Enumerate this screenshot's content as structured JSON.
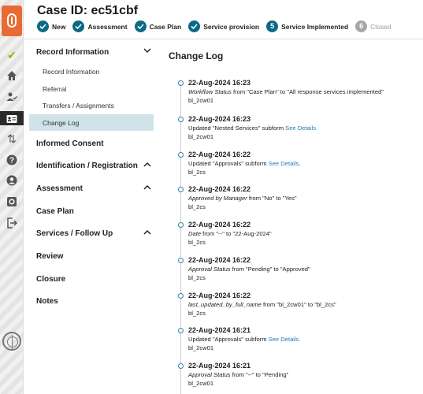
{
  "header": {
    "title": "Case ID: ec51cbf",
    "steps": [
      {
        "label": "New",
        "state": "done"
      },
      {
        "label": "Assessment",
        "state": "done"
      },
      {
        "label": "Case Plan",
        "state": "done"
      },
      {
        "label": "Service provision",
        "state": "done"
      },
      {
        "label": "Service Implemented",
        "state": "current",
        "number": "5"
      },
      {
        "label": "Closed",
        "state": "pending",
        "number": "6"
      }
    ]
  },
  "rail": {
    "icons": [
      "check-icon",
      "home-icon",
      "user-check-icon",
      "id-card-icon",
      "swap-icon",
      "help-icon",
      "user-circle-icon",
      "settings-icon",
      "logout-icon"
    ]
  },
  "nav": {
    "record_info": {
      "label": "Record Information",
      "items": [
        "Record Information",
        "Referral",
        "Transfers / Assignments",
        "Change Log"
      ]
    },
    "informed_consent": "Informed Consent",
    "identification": "Identification / Registration",
    "assessment": "Assessment",
    "case_plan": "Case Plan",
    "services": "Services / Follow Up",
    "review": "Review",
    "closure": "Closure",
    "notes": "Notes"
  },
  "main": {
    "title": "Change Log",
    "see_details": "See Details.",
    "entries": [
      {
        "date": "22-Aug-2024 16:23",
        "field": "Workflow Status",
        "rest": " from \"Case Plan\" to \"All response services implemented\"",
        "user": "bl_2cw01"
      },
      {
        "date": "22-Aug-2024 16:23",
        "prefix": "Updated \"Nested Services\" subform ",
        "user": "bl_2cw01"
      },
      {
        "date": "22-Aug-2024 16:22",
        "prefix": "Updated \"Approvals\" subform ",
        "user": "bl_2cs"
      },
      {
        "date": "22-Aug-2024 16:22",
        "field": "Approved by Manager",
        "rest": " from \"No\" to \"Yes\"",
        "user": "bl_2cs"
      },
      {
        "date": "22-Aug-2024 16:22",
        "field": "Date",
        "rest": " from \"--\" to \"22-Aug-2024\"",
        "user": "bl_2cs"
      },
      {
        "date": "22-Aug-2024 16:22",
        "field": "Approval Status",
        "rest": " from \"Pending\" to \"Approved\"",
        "user": "bl_2cs"
      },
      {
        "date": "22-Aug-2024 16:22",
        "field": "last_updated_by_full_name",
        "rest": " from \"bl_2cw01\" to \"bl_2cs\"",
        "user": "bl_2cs"
      },
      {
        "date": "22-Aug-2024 16:21",
        "prefix": "Updated \"Approvals\" subform ",
        "user": "bl_2cw01"
      },
      {
        "date": "22-Aug-2024 16:21",
        "field": "Approval Status",
        "rest": " from \"--\" to \"Pending\"",
        "user": "bl_2cw01"
      }
    ]
  },
  "colors": {
    "step_active": "#0b6a86",
    "step_inactive": "#a6a6a6",
    "nav_active_bg": "#cfe3e9",
    "link": "#1e7cb6",
    "brand": "#e96b33"
  }
}
